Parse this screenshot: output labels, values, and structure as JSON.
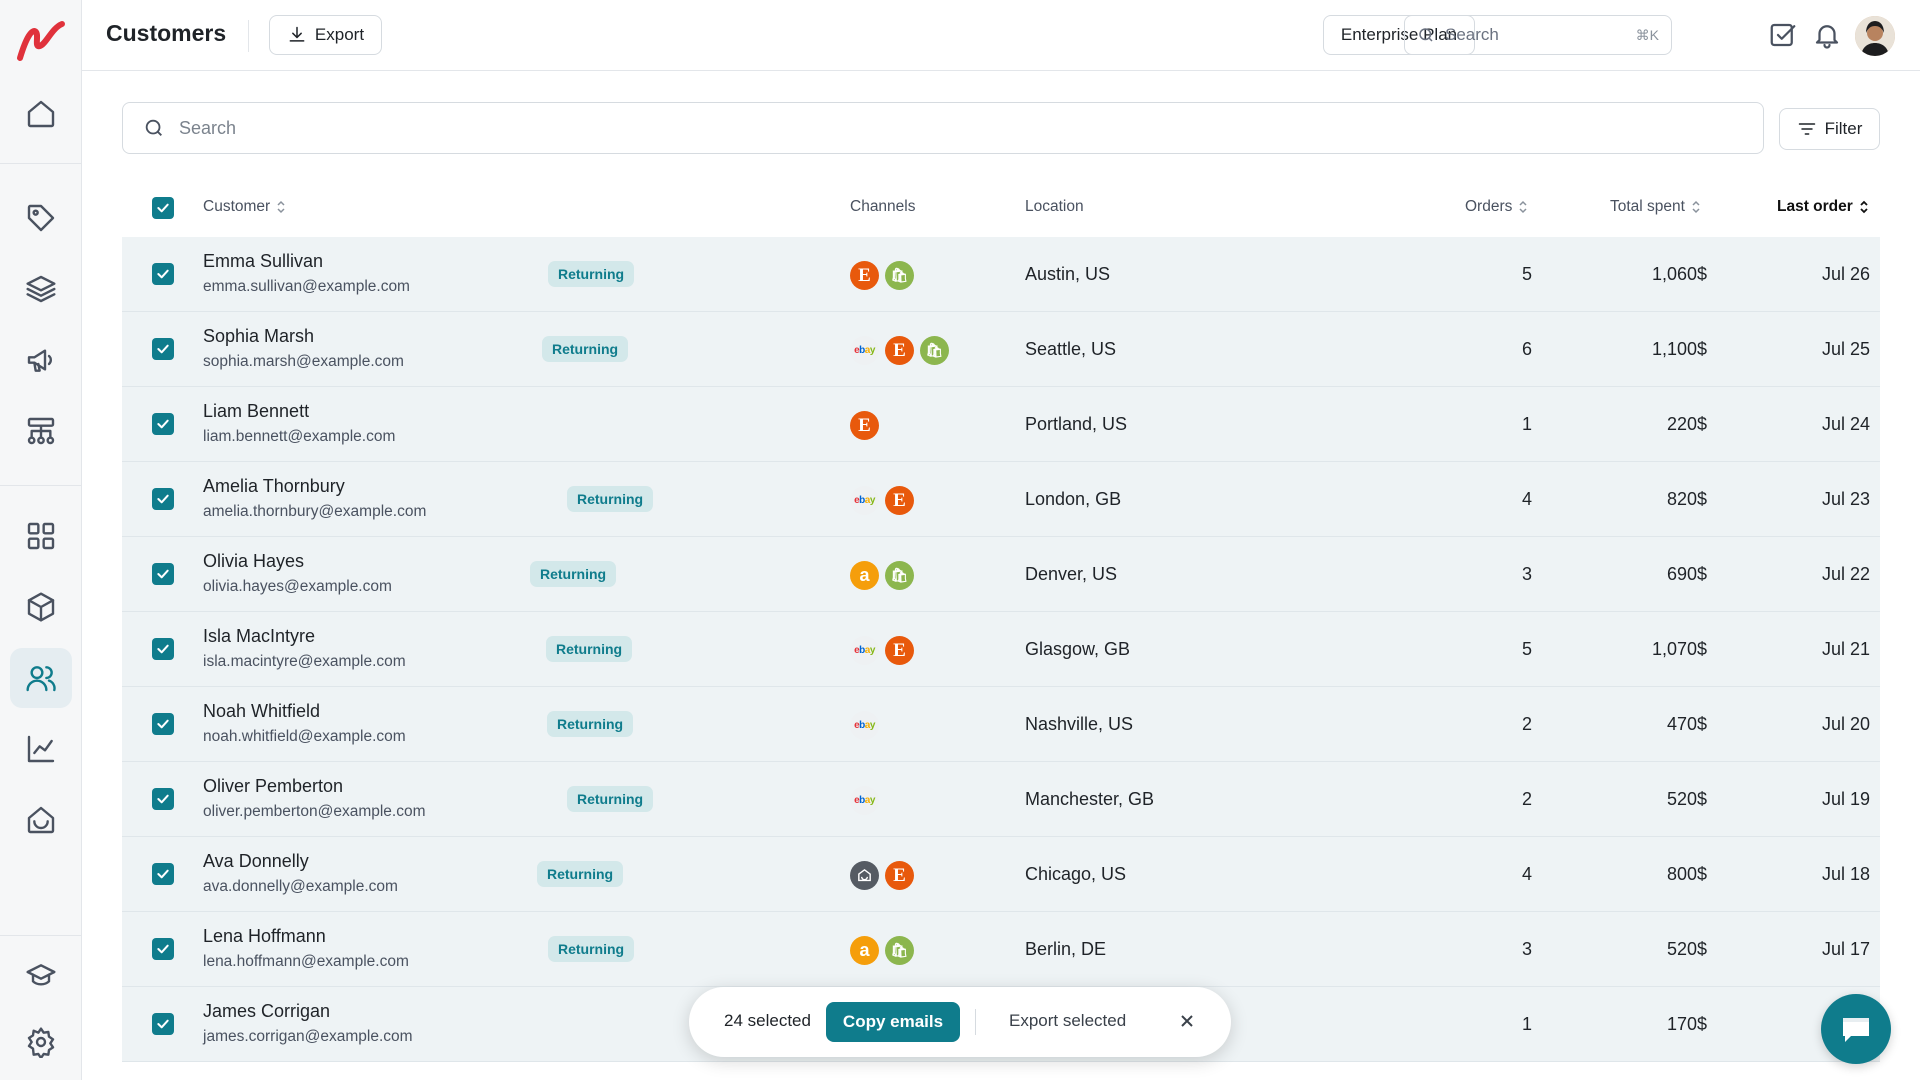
{
  "header": {
    "title": "Customers",
    "export_label": "Export",
    "plan_label": "Enterprise Plan",
    "search_placeholder": "Search",
    "search_shortcut": "⌘K"
  },
  "sidebar": {
    "items": [
      {
        "name": "home-icon"
      },
      {
        "name": "tag-icon"
      },
      {
        "name": "layers-icon"
      },
      {
        "name": "megaphone-icon"
      },
      {
        "name": "workflow-icon"
      },
      {
        "name": "grid-icon"
      },
      {
        "name": "box-icon"
      },
      {
        "name": "users-icon",
        "active": true
      },
      {
        "name": "chart-icon"
      },
      {
        "name": "inbox-icon"
      },
      {
        "name": "graduation-cap-icon"
      },
      {
        "name": "gear-icon"
      }
    ]
  },
  "main": {
    "search_placeholder": "Search",
    "filter_label": "Filter"
  },
  "table": {
    "columns": {
      "customer": "Customer",
      "channels": "Channels",
      "location": "Location",
      "orders": "Orders",
      "total_spent": "Total spent",
      "last_order": "Last order"
    },
    "rows": [
      {
        "name": "Emma Sullivan",
        "email": "emma.sullivan@example.com",
        "badge": "Returning",
        "channels": [
          "etsy",
          "shopify"
        ],
        "location": "Austin, US",
        "orders": "5",
        "spent": "1,060$",
        "last": "Jul 26"
      },
      {
        "name": "Sophia Marsh",
        "email": "sophia.marsh@example.com",
        "badge": "Returning",
        "channels": [
          "ebay",
          "etsy",
          "shopify"
        ],
        "location": "Seattle, US",
        "orders": "6",
        "spent": "1,100$",
        "last": "Jul 25"
      },
      {
        "name": "Liam Bennett",
        "email": "liam.bennett@example.com",
        "badge": "",
        "channels": [
          "etsy"
        ],
        "location": "Portland, US",
        "orders": "1",
        "spent": "220$",
        "last": "Jul 24"
      },
      {
        "name": "Amelia Thornbury",
        "email": "amelia.thornbury@example.com",
        "badge": "Returning",
        "channels": [
          "ebay",
          "etsy"
        ],
        "location": "London, GB",
        "orders": "4",
        "spent": "820$",
        "last": "Jul 23"
      },
      {
        "name": "Olivia Hayes",
        "email": "olivia.hayes@example.com",
        "badge": "Returning",
        "channels": [
          "amazon",
          "shopify"
        ],
        "location": "Denver, US",
        "orders": "3",
        "spent": "690$",
        "last": "Jul 22"
      },
      {
        "name": "Isla MacIntyre",
        "email": "isla.macintyre@example.com",
        "badge": "Returning",
        "channels": [
          "ebay",
          "etsy"
        ],
        "location": "Glasgow, GB",
        "orders": "5",
        "spent": "1,070$",
        "last": "Jul 21"
      },
      {
        "name": "Noah Whitfield",
        "email": "noah.whitfield@example.com",
        "badge": "Returning",
        "channels": [
          "ebay"
        ],
        "location": "Nashville, US",
        "orders": "2",
        "spent": "470$",
        "last": "Jul 20"
      },
      {
        "name": "Oliver Pemberton",
        "email": "oliver.pemberton@example.com",
        "badge": "Returning",
        "channels": [
          "ebay"
        ],
        "location": "Manchester, GB",
        "orders": "2",
        "spent": "520$",
        "last": "Jul 19"
      },
      {
        "name": "Ava Donnelly",
        "email": "ava.donnelly@example.com",
        "badge": "Returning",
        "channels": [
          "store",
          "etsy"
        ],
        "location": "Chicago, US",
        "orders": "4",
        "spent": "800$",
        "last": "Jul 18"
      },
      {
        "name": "Lena Hoffmann",
        "email": "lena.hoffmann@example.com",
        "badge": "Returning",
        "channels": [
          "amazon",
          "shopify"
        ],
        "location": "Berlin, DE",
        "orders": "3",
        "spent": "520$",
        "last": "Jul 17"
      },
      {
        "name": "James Corrigan",
        "email": "james.corrigan@example.com",
        "badge": "",
        "channels": [],
        "location": "",
        "orders": "1",
        "spent": "170$",
        "last": ""
      }
    ]
  },
  "selection": {
    "count_label": "24 selected",
    "copy_label": "Copy emails",
    "export_label": "Export selected"
  },
  "colors": {
    "accent": "#0f7c8c",
    "logo": "#e0323c",
    "row_selected": "#eef3f5",
    "badge_bg": "#d3e8ea"
  }
}
